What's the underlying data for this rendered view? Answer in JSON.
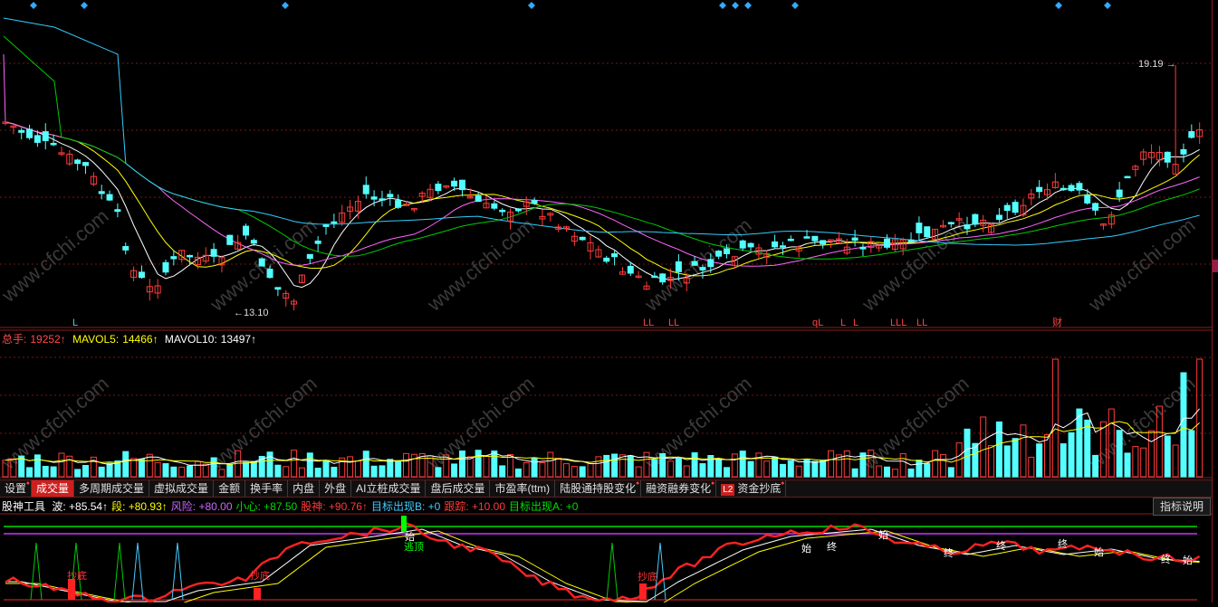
{
  "top_markers_count": 11,
  "price_panel": {
    "high_label": "19.19",
    "low_label": "13.10",
    "signal_labels": [
      "L",
      "LL",
      "LL",
      "qL",
      "L",
      "L",
      "LLL",
      "LL",
      "财"
    ],
    "colors": {
      "up": "#ff3b3b",
      "down": "#54ffff",
      "ma5": "#ffffff",
      "ma10": "#ffff00",
      "ma20": "#ff66ff",
      "ma30": "#00cc00",
      "ma60": "#33ccff",
      "grid": "#7a1515",
      "marker": "#33aaff"
    }
  },
  "volume_panel": {
    "total_label": "总手:",
    "total_value": "19252↑",
    "mavol5_label": "MAVOL5:",
    "mavol5_value": "14466↑",
    "mavol10_label": "MAVOL10:",
    "mavol10_value": "13497↑"
  },
  "tabs": [
    {
      "label": "设置",
      "mark": "●"
    },
    {
      "label": "成交量",
      "active": true
    },
    {
      "label": "多周期成交量"
    },
    {
      "label": "虚拟成交量"
    },
    {
      "label": "金额"
    },
    {
      "label": "换手率"
    },
    {
      "label": "内盘"
    },
    {
      "label": "外盘"
    },
    {
      "label": "AI立桩成交量"
    },
    {
      "label": "盘后成交量"
    },
    {
      "label": "市盈率(ttm)"
    },
    {
      "label": "陆股通持股变化",
      "mark": "●"
    },
    {
      "label": "融资融券变化",
      "mark": "●"
    },
    {
      "label": "资金抄底",
      "icon": "L2",
      "mark": "●"
    }
  ],
  "indicator_panel": {
    "name": "股神工具",
    "items": [
      {
        "label": "波:",
        "value": "+85.54↑",
        "color": "#ffffff"
      },
      {
        "label": "段:",
        "value": "+80.93↑",
        "color": "#ffff00"
      },
      {
        "label": "风险:",
        "value": "+80.00",
        "color": "#cc66ff"
      },
      {
        "label": "小心:",
        "value": "+87.50",
        "color": "#00dd00"
      },
      {
        "label": "股神:",
        "value": "+90.76↑",
        "color": "#ff3b3b"
      },
      {
        "label": "目标出现B:",
        "value": "+0",
        "color": "#44ccff"
      },
      {
        "label": "跟踪:",
        "value": "+10.00",
        "color": "#ff3b3b"
      },
      {
        "label": "目标出现A:",
        "value": "+0",
        "color": "#00dd00"
      }
    ],
    "help_button": "指标说明",
    "signal_labels": [
      "抄底",
      "抄底",
      "抄底",
      "逃顶",
      "始",
      "始",
      "终",
      "终",
      "始",
      "终",
      "始",
      "始",
      "终",
      "终"
    ]
  },
  "watermark": "www.cfchi.com"
}
